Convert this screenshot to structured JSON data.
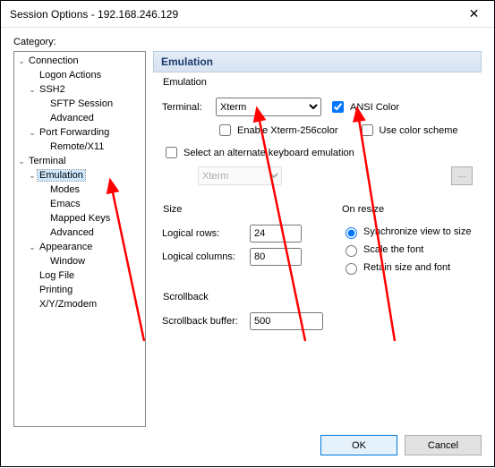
{
  "title": "Session Options - 192.168.246.129",
  "category_label": "Category:",
  "tree": {
    "connection": "Connection",
    "logon_actions": "Logon Actions",
    "ssh2": "SSH2",
    "sftp_session": "SFTP Session",
    "ssh_advanced": "Advanced",
    "port_forwarding": "Port Forwarding",
    "remote_x11": "Remote/X11",
    "terminal": "Terminal",
    "emulation": "Emulation",
    "modes": "Modes",
    "emacs": "Emacs",
    "mapped_keys": "Mapped Keys",
    "emu_advanced": "Advanced",
    "appearance": "Appearance",
    "window": "Window",
    "log_file": "Log File",
    "printing": "Printing",
    "xyzmodem": "X/Y/Zmodem"
  },
  "panel": {
    "header": "Emulation",
    "emulation_group": "Emulation",
    "terminal_label": "Terminal:",
    "terminal_value": "Xterm",
    "ansi_color": "ANSI Color",
    "enable_256": "Enable Xterm-256color",
    "use_color_scheme": "Use color scheme",
    "select_alt": "Select an alternate keyboard emulation",
    "alt_value": "Xterm",
    "dots": "...",
    "size_group": "Size",
    "logical_rows": "Logical rows:",
    "rows_value": "24",
    "logical_cols": "Logical columns:",
    "cols_value": "80",
    "on_resize": "On resize",
    "sync": "Synchronize view to size",
    "scale_font": "Scale the font",
    "retain": "Retain size and font",
    "scrollback_group": "Scrollback",
    "scrollback_buffer": "Scrollback buffer:",
    "buffer_value": "500"
  },
  "buttons": {
    "ok": "OK",
    "cancel": "Cancel"
  }
}
